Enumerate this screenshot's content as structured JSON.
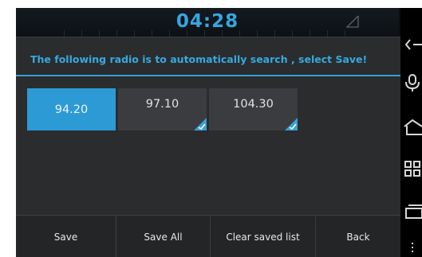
{
  "status_bar": {
    "time": "04:28"
  },
  "dialog": {
    "title": "The following radio is to automatically search , select Save!",
    "stations": [
      {
        "frequency": "94.20",
        "selected": true,
        "saved": false
      },
      {
        "frequency": "97.10",
        "selected": false,
        "saved": true
      },
      {
        "frequency": "104.30",
        "selected": false,
        "saved": true
      }
    ],
    "actions": {
      "save_label": "Save",
      "save_all_label": "Save All",
      "clear_label": "Clear saved list",
      "back_label": "Back"
    }
  },
  "nav_bar": {
    "icons": [
      "back-icon",
      "microphone-icon",
      "home-icon",
      "recent-apps-icon",
      "menu-icon",
      "more-dots-icon"
    ]
  },
  "colors": {
    "accent": "#37a9df",
    "selected_station": "#2c9ad5",
    "dialog_background": "#2a2c2e",
    "station_background": "#3a3c3f"
  }
}
